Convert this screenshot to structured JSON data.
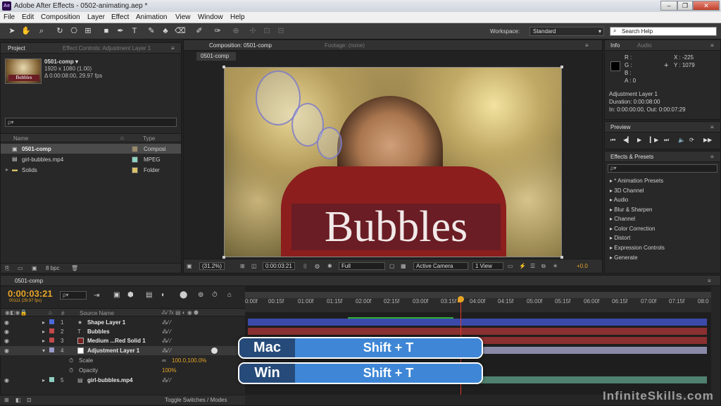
{
  "window": {
    "title": "Adobe After Effects - 0502-animating.aep *",
    "app_badge": "Ae",
    "min": "‒",
    "max": "❐",
    "close": "✕"
  },
  "menu": [
    "File",
    "Edit",
    "Composition",
    "Layer",
    "Effect",
    "Animation",
    "View",
    "Window",
    "Help"
  ],
  "toolbar": {
    "workspace_label": "Workspace:",
    "workspace_value": "Standard",
    "search_placeholder": "Search Help"
  },
  "project": {
    "tab": "Project",
    "tab2": "Effect Controls: Adjustment Layer 1",
    "comp_name": "0501-comp ▾",
    "comp_res": "1920 x 1080 (1.00)",
    "comp_dur": "Δ 0:00:08:00, 29.97 fps",
    "search": "ρ▾",
    "col_name": "Name",
    "col_type": "Type",
    "items": [
      {
        "name": "0501-comp",
        "type": "Composi",
        "color": "#9a8a6a"
      },
      {
        "name": "girl-bubbles.mp4",
        "type": "MPEG",
        "color": "#8fd0c0"
      },
      {
        "name": "Solids",
        "type": "Folder",
        "color": "#d8c06a"
      }
    ],
    "bpc": "8 bpc"
  },
  "composition": {
    "tab": "Composition: 0501-comp",
    "tab2": "Footage: (none)",
    "subtab": "0501-comp",
    "title_text": "Bubbles",
    "zoom": "(31.2%)",
    "timecode": "0:00:03:21",
    "resolution": "Full",
    "camera": "Active Camera",
    "views": "1 View",
    "exposure": "+0.0"
  },
  "info": {
    "tab": "Info",
    "tab2": "Audio",
    "r": "R :",
    "g": "G :",
    "b": "B :",
    "a": "A : 0",
    "x": "X : -225",
    "y": "Y : 1079",
    "layer": "Adjustment Layer 1",
    "duration": "Duration: 0:00:08:00",
    "inout": "In: 0:00:00:00, Out: 0:00:07:29"
  },
  "preview": {
    "tab": "Preview"
  },
  "effects": {
    "tab": "Effects & Presets",
    "search": "ρ▾",
    "items": [
      "* Animation Presets",
      "3D Channel",
      "Audio",
      "Blur & Sharpen",
      "Channel",
      "Color Correction",
      "Distort",
      "Expression Controls",
      "Generate"
    ]
  },
  "timeline": {
    "tab": "0501-comp",
    "timecode": "0:00:03:21",
    "frames": "00111 (29.97 fps)",
    "search": "ρ▾",
    "col_source": "Source Name",
    "col_num": "#",
    "ruler": [
      "0:00f",
      "00:15f",
      "01:00f",
      "01:15f",
      "02:00f",
      "02:15f",
      "03:00f",
      "03:15f",
      "04:00f",
      "04:15f",
      "05:00f",
      "05:15f",
      "06:00f",
      "06:15f",
      "07:00f",
      "07:15f",
      "08:0"
    ],
    "layers": [
      {
        "num": "1",
        "name": "Shape Layer 1",
        "color": "#4a6ad8",
        "icon": "★"
      },
      {
        "num": "2",
        "name": "Bubbles",
        "color": "#c24a4a",
        "icon": "T"
      },
      {
        "num": "3",
        "name": "Medium ...Red Solid 1",
        "color": "#c24a4a",
        "icon": "■"
      },
      {
        "num": "4",
        "name": "Adjustment Layer 1",
        "color": "#9a9ac8",
        "icon": "□"
      },
      {
        "num": "5",
        "name": "girl-bubbles.mp4",
        "color": "#8fd0c0",
        "icon": "▤"
      }
    ],
    "props": [
      {
        "name": "Scale",
        "value": "100.0,100.0%"
      },
      {
        "name": "Opacity",
        "value": "100%"
      }
    ],
    "toggle": "Toggle Switches / Modes"
  },
  "overlay": [
    {
      "key": "Mac",
      "value": "Shift + T"
    },
    {
      "key": "Win",
      "value": "Shift + T"
    }
  ],
  "watermark": "InfiniteSkills.com"
}
